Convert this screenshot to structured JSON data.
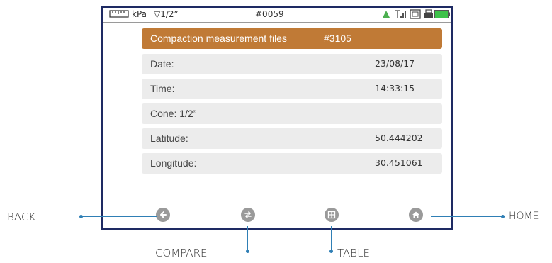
{
  "status": {
    "unit": "kPa",
    "cone": "▽1/2”",
    "file_no": "#0059"
  },
  "record": {
    "title": "Compaction measurement files",
    "number": "#3105",
    "fields": [
      {
        "label": "Date:",
        "value": "23/08/17"
      },
      {
        "label": "Time:",
        "value": "14:33:15"
      },
      {
        "label": "Cone: 1/2”",
        "value": ""
      },
      {
        "label": "Latitude:",
        "value": "50.444202"
      },
      {
        "label": "Longitude:",
        "value": "30.451061"
      }
    ]
  },
  "callouts": {
    "back": "BACK",
    "compare": "COMPARE",
    "table": "TABLE",
    "home": "HOME"
  },
  "colors": {
    "header": "#c07a36",
    "row_bg": "#ececec",
    "frame": "#1e2a63",
    "callout_line": "#2f7fb5",
    "icon": "#9a9a9a",
    "battery": "#3ec24a"
  },
  "icons": [
    "ruler-icon",
    "signal-icon",
    "gps-icon",
    "sd-card-icon",
    "printer-icon",
    "battery-icon",
    "back-arrow-icon",
    "compare-icon",
    "table-icon",
    "home-icon"
  ]
}
